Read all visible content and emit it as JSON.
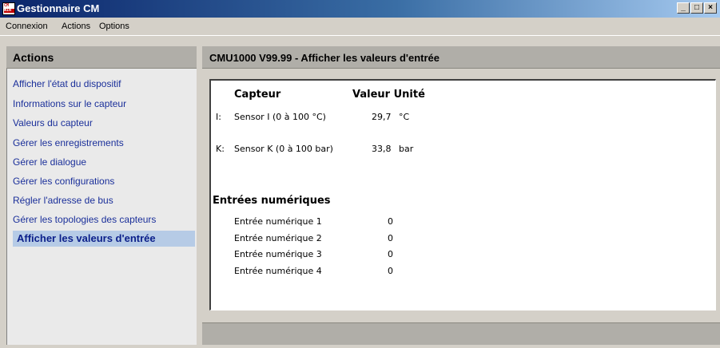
{
  "window": {
    "title": "Gestionnaire CM",
    "icon_text": "CM WIN",
    "controls": [
      "_",
      "□",
      "×"
    ]
  },
  "menu": [
    "Connexion",
    "Actions",
    "Options"
  ],
  "sidebar": {
    "title": "Actions",
    "items": [
      {
        "label": "Afficher l'état du dispositif",
        "active": false
      },
      {
        "label": "Informations sur le capteur",
        "active": false
      },
      {
        "label": "Valeurs du capteur",
        "active": false
      },
      {
        "label": "Gérer les enregistrements",
        "active": false
      },
      {
        "label": "Gérer le dialogue",
        "active": false
      },
      {
        "label": "Gérer les configurations",
        "active": false
      },
      {
        "label": "Régler l'adresse de bus",
        "active": false
      },
      {
        "label": "Gérer les topologies des capteurs",
        "active": false
      },
      {
        "label": "Afficher les valeurs d'entrée",
        "active": true
      }
    ]
  },
  "main": {
    "title": "CMU1000 V99.99 - Afficher les valeurs d'entrée",
    "headers": {
      "sensor": "Capteur",
      "value_unit": "Valeur Unité"
    },
    "sensors": [
      {
        "prefix": "I:",
        "name": "Sensor I (0 à 100 °C)",
        "value": "29,7",
        "unit": "°C"
      },
      {
        "prefix": "K:",
        "name": "Sensor K (0 à 100 bar)",
        "value": "33,8",
        "unit": "bar"
      }
    ],
    "digital_title": "Entrées numériques",
    "digital_inputs": [
      {
        "label": "Entrée numérique 1",
        "value": "0"
      },
      {
        "label": "Entrée numérique 2",
        "value": "0"
      },
      {
        "label": "Entrée numérique 3",
        "value": "0"
      },
      {
        "label": "Entrée numérique 4",
        "value": "0"
      }
    ]
  },
  "colors": {
    "titlebar_start": "#0a246a",
    "titlebar_end": "#a6caf0",
    "link": "#1a2f9a",
    "active_bg": "#b6cbe6"
  }
}
